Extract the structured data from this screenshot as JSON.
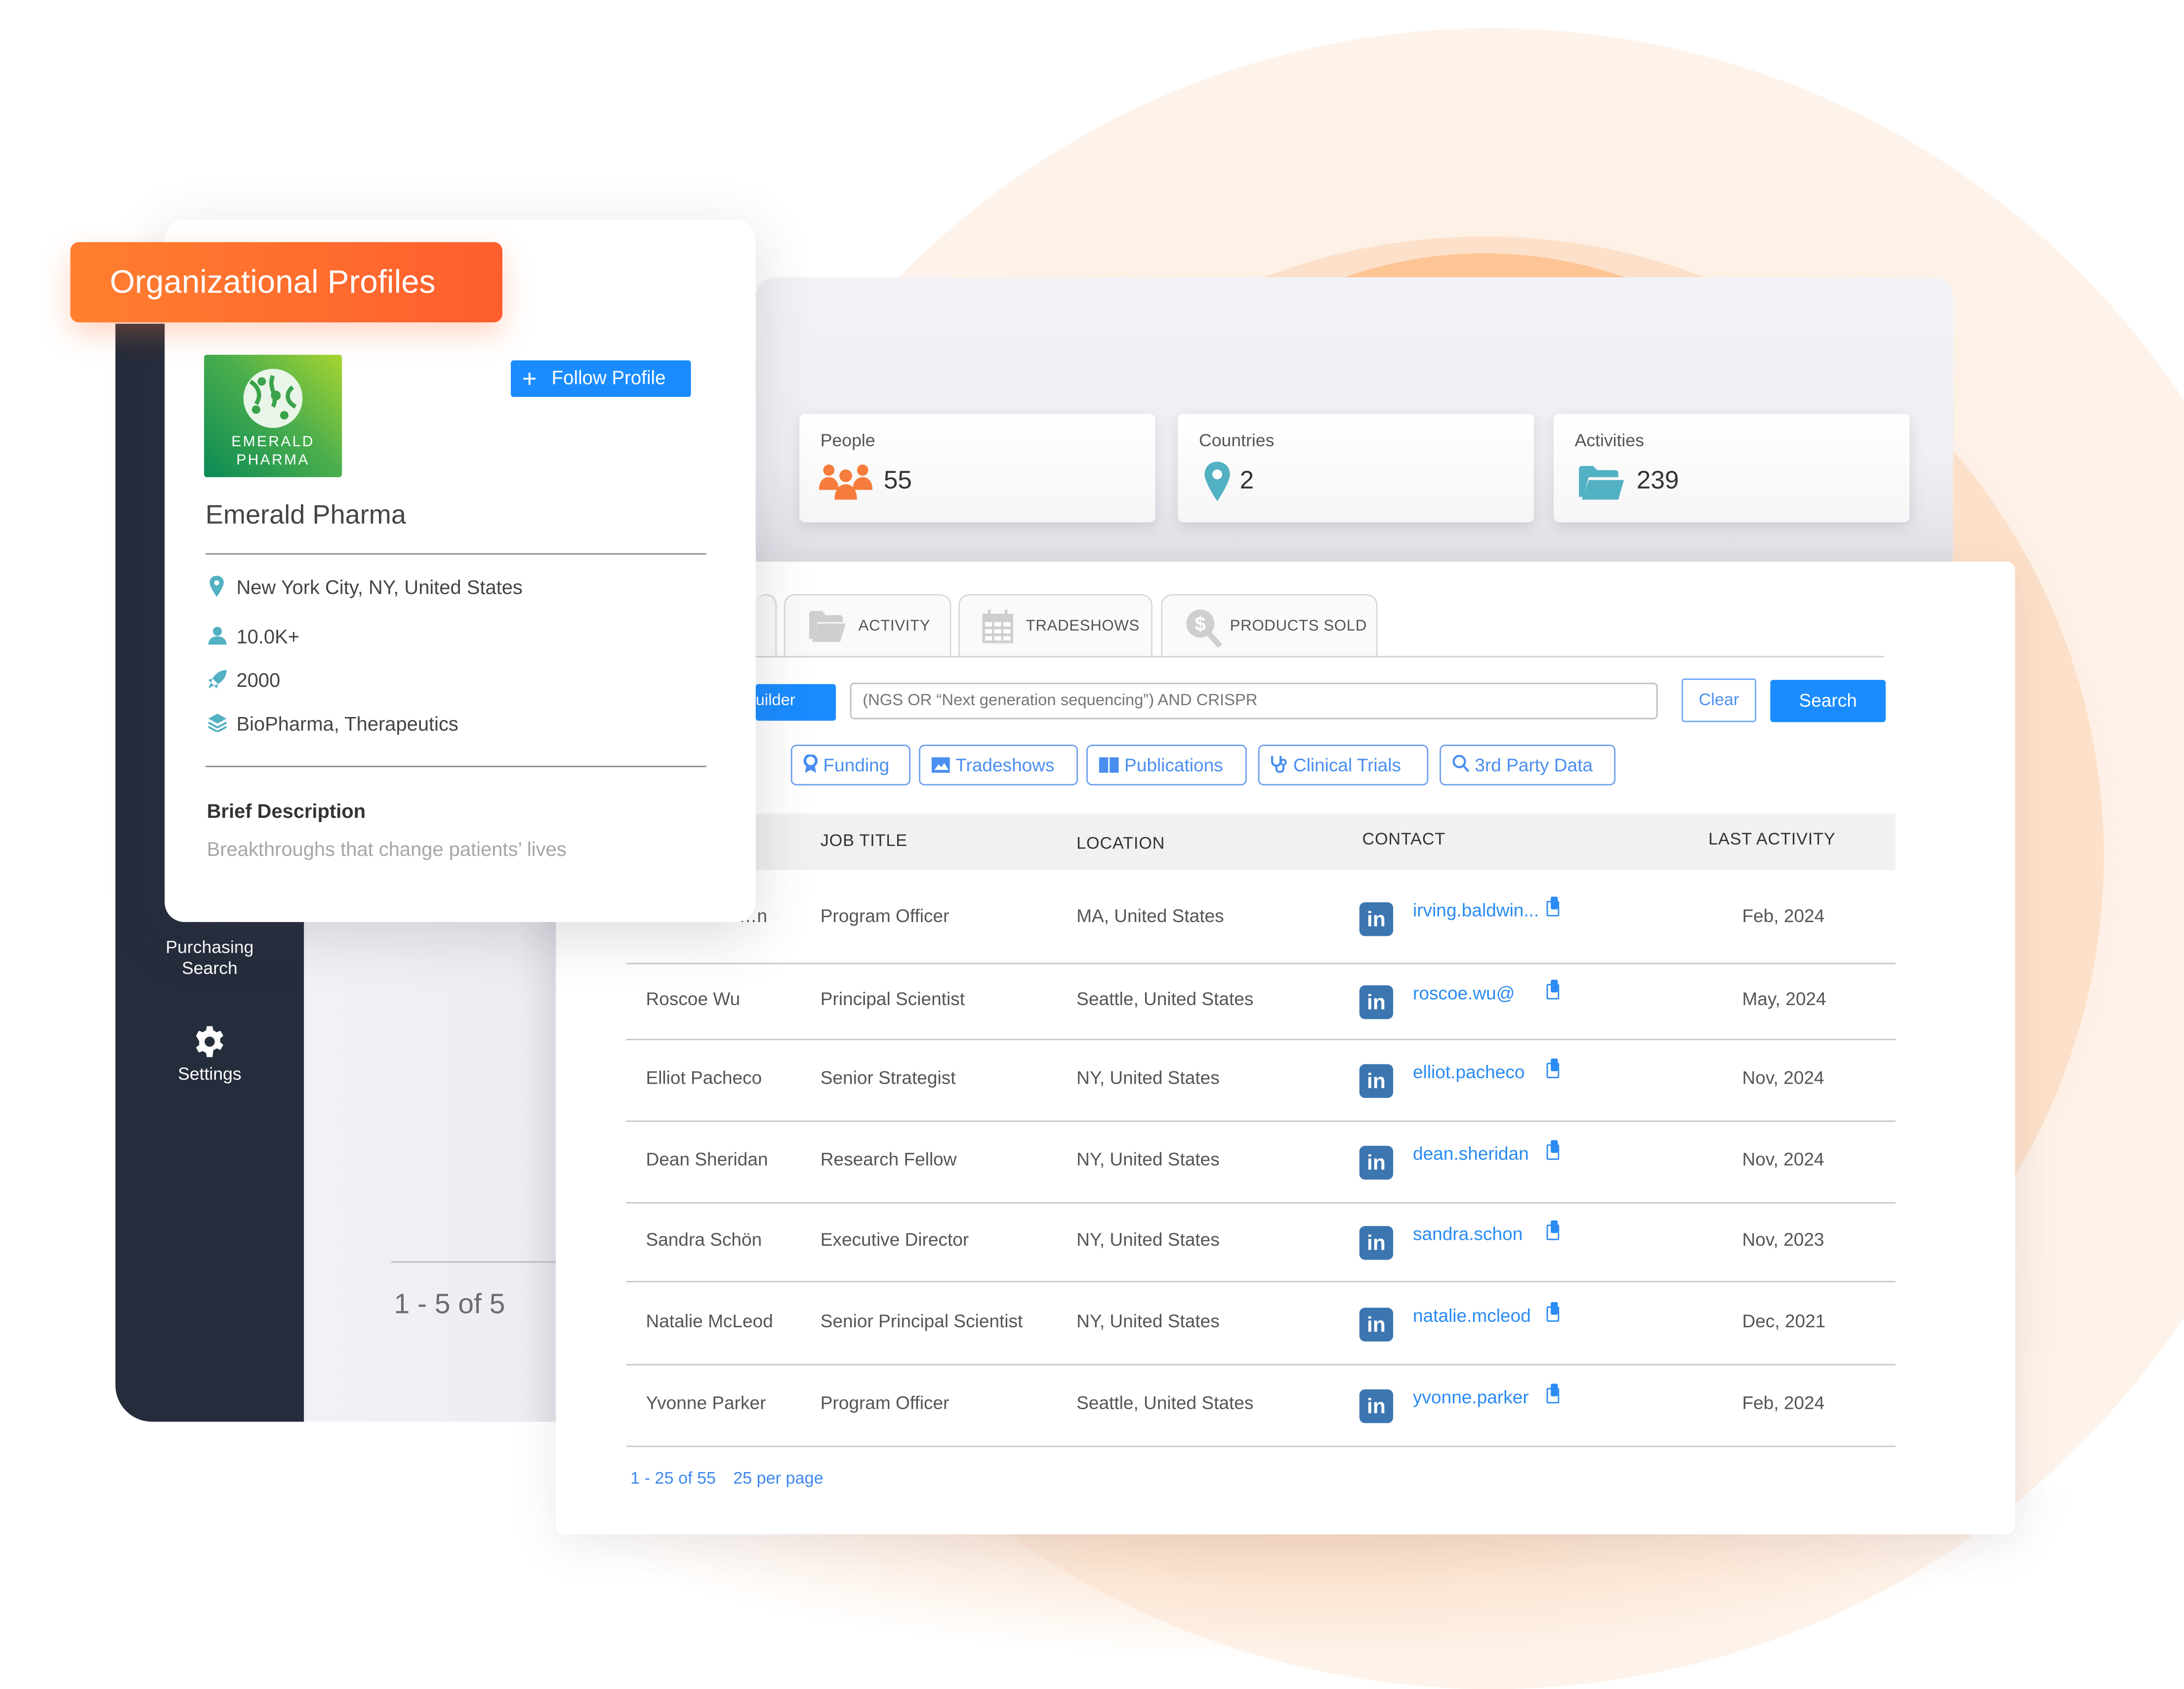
{
  "banner": {
    "title": "Organizational Profiles"
  },
  "profile": {
    "logo_line1": "EMERALD",
    "logo_line2": "PHARMA",
    "follow_label": "Follow Profile",
    "name": "Emerald Pharma",
    "location": "New York City, NY, United States",
    "employees": "10.0K+",
    "founded": "2000",
    "industry": "BioPharma, Therapeutics",
    "brief_heading": "Brief Description",
    "brief_text": "Breakthroughs that change patients’ lives"
  },
  "sidebar": {
    "items": [
      {
        "label": "Purchasing Search",
        "icon": "search-icon"
      },
      {
        "label": "Settings",
        "icon": "gear-icon"
      }
    ]
  },
  "left_pager": {
    "text": "1 - 5 of 5"
  },
  "stats": [
    {
      "label": "People",
      "value": "55",
      "icon": "people-icon",
      "color": "#f57c3a"
    },
    {
      "label": "Countries",
      "value": "2",
      "icon": "map-pin-icon",
      "color": "#52b1c2"
    },
    {
      "label": "Activities",
      "value": "239",
      "icon": "folder-open-icon",
      "color": "#52b1c2"
    }
  ],
  "tabs": [
    {
      "label": "ACTIVITY",
      "icon": "folder-icon"
    },
    {
      "label": "TRADESHOWS",
      "icon": "calendar-icon"
    },
    {
      "label": "PRODUCTS SOLD",
      "icon": "dollar-search-icon"
    }
  ],
  "search": {
    "builder_label": "uilder",
    "query_placeholder": "(NGS OR “Next generation sequencing”) AND CRISPR",
    "clear_label": "Clear",
    "search_label": "Search"
  },
  "filters": [
    {
      "label": "Funding",
      "icon": "award-icon"
    },
    {
      "label": "Tradeshows",
      "icon": "image-icon"
    },
    {
      "label": "Publications",
      "icon": "book-icon"
    },
    {
      "label": "Clinical Trials",
      "icon": "stethoscope-icon"
    },
    {
      "label": "3rd Party Data",
      "icon": "search-icon"
    }
  ],
  "table": {
    "columns": [
      "JOB TITLE",
      "LOCATION",
      "CONTACT",
      "LAST ACTIVITY"
    ],
    "rows": [
      {
        "name": "…n",
        "title": "Program Officer",
        "location": "MA, United States",
        "email": "irving.baldwin...",
        "last": "Feb, 2024"
      },
      {
        "name": "Roscoe Wu",
        "title": "Principal Scientist",
        "location": "Seattle, United States",
        "email": "roscoe.wu@",
        "last": "May, 2024"
      },
      {
        "name": "Elliot Pacheco",
        "title": "Senior Strategist",
        "location": "NY, United States",
        "email": "elliot.pacheco",
        "last": "Nov, 2024"
      },
      {
        "name": "Dean Sheridan",
        "title": "Research Fellow",
        "location": "NY, United States",
        "email": "dean.sheridan",
        "last": "Nov, 2024"
      },
      {
        "name": "Sandra Schön",
        "title": "Executive Director",
        "location": "NY, United States",
        "email": "sandra.schon",
        "last": "Nov, 2023"
      },
      {
        "name": "Natalie McLeod",
        "title": "Senior Principal Scientist",
        "location": "NY, United States",
        "email": "natalie.mcleod",
        "last": "Dec, 2021"
      },
      {
        "name": "Yvonne Parker",
        "title": "Program Officer",
        "location": "Seattle, United States",
        "email": "yvonne.parker",
        "last": "Feb, 2024"
      }
    ],
    "footer_range": "1 - 25 of 55",
    "footer_per_page": "25 per page"
  },
  "colors": {
    "accent_blue": "#1a8cff",
    "banner_orange": "#ff6f2f",
    "sidebar": "#252c3b",
    "linkedin": "#3b76b0"
  }
}
